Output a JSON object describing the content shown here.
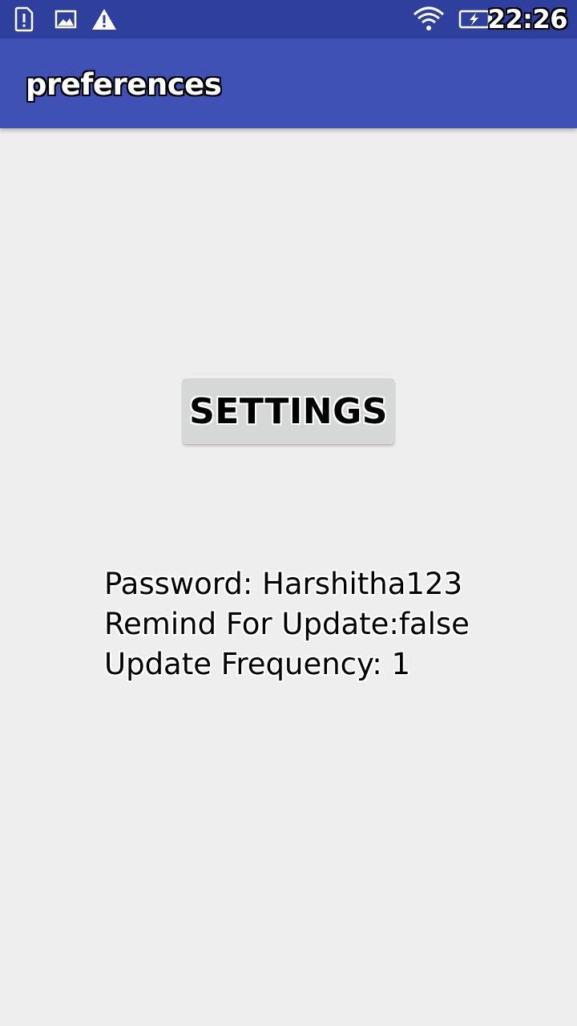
{
  "status_bar": {
    "time": "22:26",
    "icons": [
      "sim-alert-icon",
      "image-icon",
      "warning-icon",
      "wifi-icon",
      "battery-charging-icon"
    ]
  },
  "app_bar": {
    "title": "preferences",
    "color": "#3f51b5"
  },
  "main": {
    "settings_button_label": "SETTINGS",
    "password_line": "Password: Harshitha123",
    "remind_line": "Remind For Update:false",
    "frequency_line": "Update Frequency: 1"
  },
  "colors": {
    "status_bar": "#2f3f9e",
    "background": "#eeeeee",
    "button": "#d6d7d7"
  }
}
